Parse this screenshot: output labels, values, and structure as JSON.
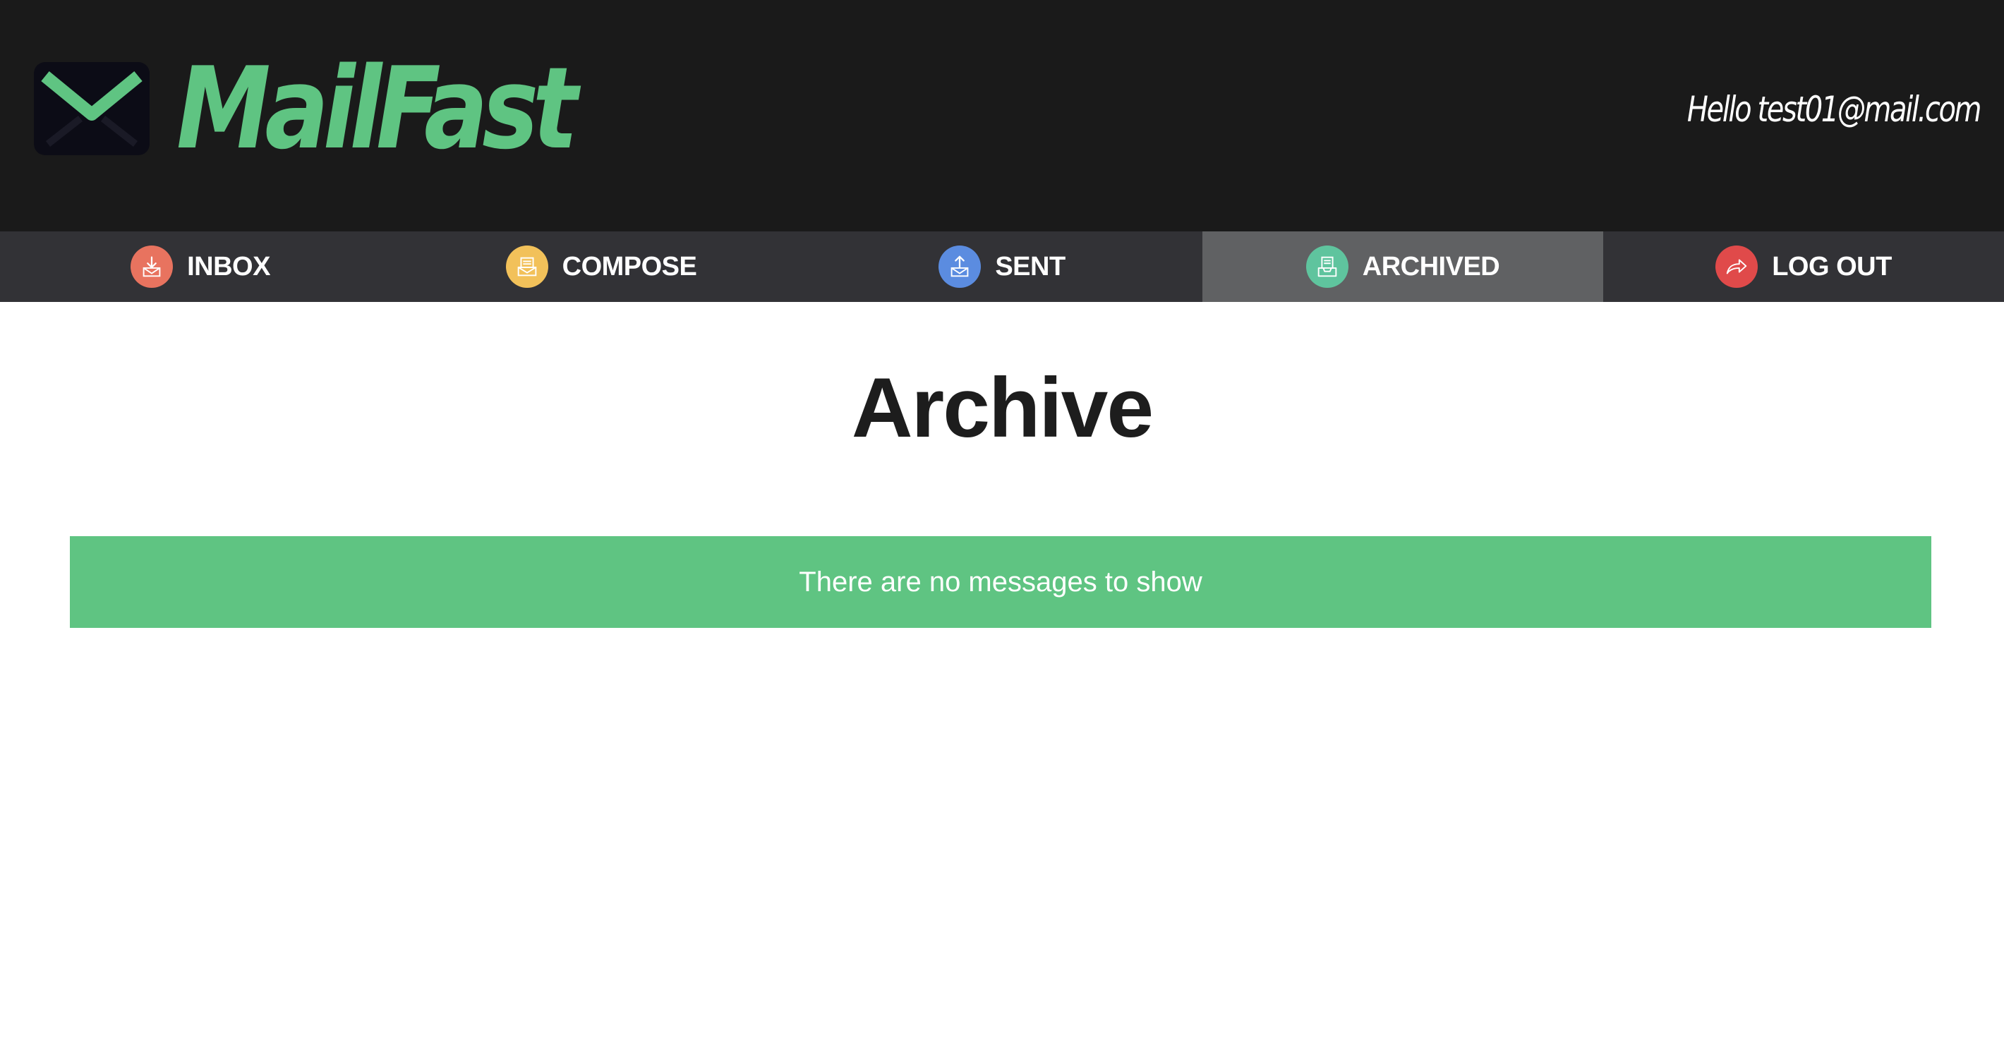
{
  "header": {
    "brand": "MailFast",
    "greeting": "Hello test01@mail.com"
  },
  "nav": {
    "items": [
      {
        "label": "INBOX",
        "icon": "inbox-download-icon",
        "color": "#e8735f",
        "active": false
      },
      {
        "label": "COMPOSE",
        "icon": "compose-icon",
        "color": "#f2c15a",
        "active": false
      },
      {
        "label": "SENT",
        "icon": "sent-upload-icon",
        "color": "#5b8ce0",
        "active": false
      },
      {
        "label": "ARCHIVED",
        "icon": "archive-tray-icon",
        "color": "#5fc49e",
        "active": true
      },
      {
        "label": "LOG OUT",
        "icon": "logout-arrow-icon",
        "color": "#e04a4a",
        "active": false
      }
    ]
  },
  "main": {
    "title": "Archive",
    "empty_message": "There are no messages to show"
  },
  "colors": {
    "brand_green": "#5fc482",
    "header_bg": "#1a1a1a",
    "nav_bg": "#323236",
    "nav_active_bg": "#606163"
  }
}
